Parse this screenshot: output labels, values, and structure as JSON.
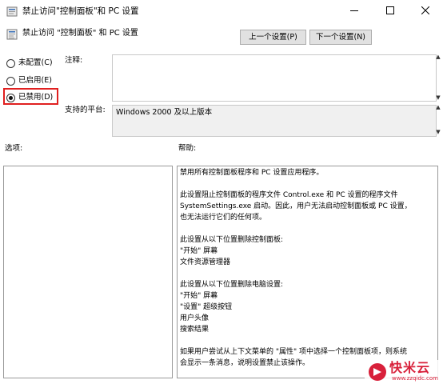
{
  "window": {
    "title": "禁止访问\"控制面板\"和 PC 设置",
    "buttons": [
      "minimize",
      "maximize",
      "close"
    ]
  },
  "header": {
    "title": "禁止访问 \"控制面板\" 和 PC 设置",
    "prev_button": "上一个设置(P)",
    "next_button": "下一个设置(N)"
  },
  "state": {
    "options": [
      "未配置(C)",
      "已启用(E)",
      "已禁用(D)"
    ],
    "selected": "已禁用(D)"
  },
  "comment": {
    "label": "注释:",
    "value": ""
  },
  "supported": {
    "label": "支持的平台:",
    "value": "Windows 2000 及以上版本"
  },
  "options_section": {
    "label": "选项:"
  },
  "help_section": {
    "label": "帮助:",
    "lines": [
      "禁用所有控制面板程序和 PC 设置应用程序。",
      "",
      "此设置阻止控制面板的程序文件 Control.exe 和 PC 设置的程序文件",
      "SystemSettings.exe 启动。因此，用户无法启动控制面板或 PC 设置，",
      "也无法运行它们的任何项。",
      "",
      "此设置从以下位置删除控制面板:",
      "\"开始\" 屏幕",
      "文件资源管理器",
      "",
      "此设置从以下位置删除电脑设置:",
      "\"开始\" 屏幕",
      "\"设置\" 超级按钮",
      "用户头像",
      "搜索结果",
      "",
      "如果用户尝试从上下文菜单的 \"属性\" 项中选择一个控制面板项，则系统",
      "会显示一条消息，说明设置禁止该操作。"
    ]
  },
  "watermark": {
    "name": "快米云",
    "url": "www.zzqidc.com"
  },
  "colors": {
    "highlight": "#e02020",
    "watermark": "#d8203a",
    "button_bg": "#e1e1e1",
    "readonly_bg": "#f0f0f0"
  },
  "icons": [
    "policy-icon",
    "minimize-icon",
    "maximize-icon",
    "close-icon",
    "scroll-up-icon",
    "scroll-down-icon",
    "watermark-logo-icon"
  ]
}
